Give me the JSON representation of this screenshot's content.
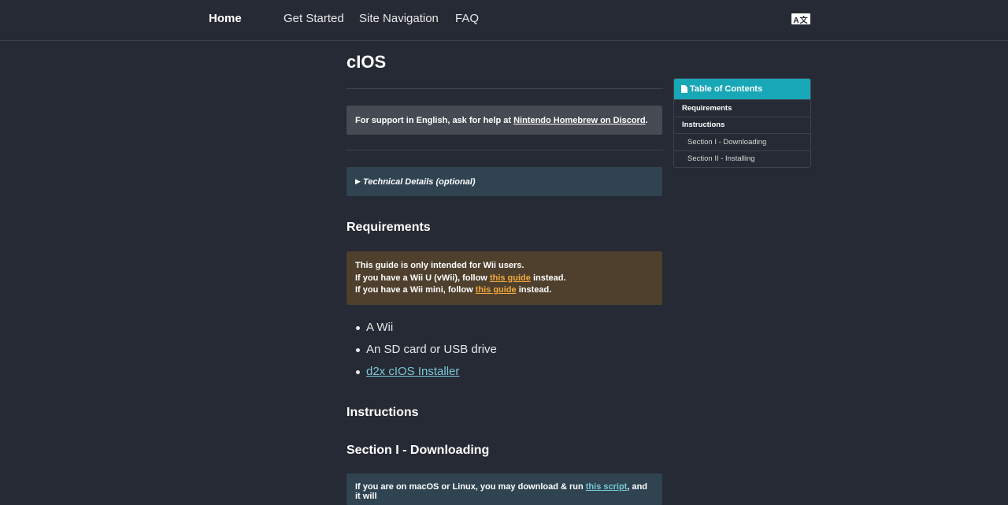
{
  "header": {
    "home_label": "Home",
    "nav_items": [
      "Get Started",
      "Site Navigation",
      "FAQ"
    ],
    "language_icon": "translate-icon"
  },
  "page": {
    "title": "cIOS"
  },
  "support_notice": {
    "prefix": "For support in English, ask for help at ",
    "link_text": "Nintendo Homebrew on Discord",
    "suffix": "."
  },
  "details": {
    "arrow": "▶",
    "label": "Technical Details (optional)"
  },
  "requirements": {
    "heading": "Requirements",
    "warning": {
      "line1": "This guide is only intended for Wii users.",
      "line2_prefix": "If you have a Wii U (vWii), follow ",
      "line2_link": "this guide",
      "line2_suffix": " instead.",
      "line3_prefix": "If you have a Wii mini, follow ",
      "line3_link": "this guide",
      "line3_suffix": " instead."
    },
    "items": [
      "A Wii",
      "An SD card or USB drive",
      "d2x cIOS Installer"
    ]
  },
  "instructions": {
    "heading": "Instructions",
    "section1_heading": "Section I - Downloading",
    "info": {
      "prefix": "If you are on macOS or Linux, you may download & run ",
      "link": "this script",
      "suffix": ", and it will"
    }
  },
  "toc": {
    "header": "Table of Contents",
    "items": [
      {
        "label": "Requirements"
      },
      {
        "label": "Instructions"
      },
      {
        "label": "Section I - Downloading"
      },
      {
        "label": "Section II - Installing"
      }
    ]
  },
  "colors": {
    "background": "#252a34",
    "accent": "#17a7b7",
    "link_info": "#7ac8d8",
    "link_warning": "#f3a93f"
  }
}
